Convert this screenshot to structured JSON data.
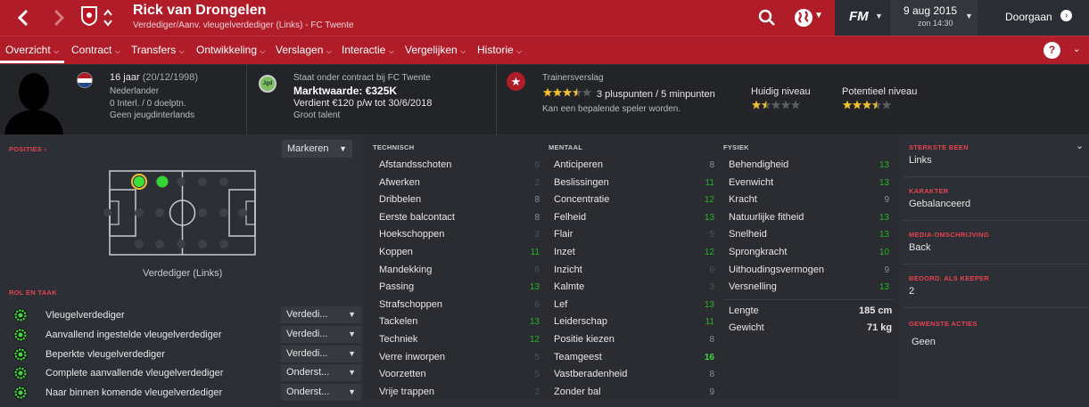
{
  "header": {
    "player_name": "Rick van Drongelen",
    "subtitle": "Verdediger/Aanv. vleugelverdediger (Links) - FC Twente",
    "date": "9 aug 2015",
    "time": "zon 14:30",
    "continue_label": "Doorgaan",
    "fm_logo": "FM"
  },
  "nav": {
    "items": [
      "Overzicht",
      "Contract",
      "Transfers",
      "Ontwikkeling",
      "Verslagen",
      "Interactie",
      "Vergelijken",
      "Historie"
    ],
    "help": "?"
  },
  "info": {
    "age": "16 jaar",
    "dob": "(20/12/1998)",
    "nationality": "Nederlander",
    "caps": "0 Interl. / 0 doelptn.",
    "youth_caps": "Geen jeugdinterlands",
    "contract_status": "Staat onder contract bij FC Twente",
    "club_badge": "Jgd",
    "market_value": "Marktwaarde: €325K",
    "wage": "Verdient €120 p/w tot 30/6/2018",
    "talent": "Groot talent",
    "scout_title": "Trainersverslag",
    "scout_points": "3 pluspunten / 5 minpunten",
    "scout_note": "Kan een bepalende speler worden.",
    "current_level_label": "Huidig niveau",
    "potential_level_label": "Potentieel niveau",
    "scout_stars": 3.5,
    "current_stars": 1.5,
    "potential_stars": 3.5
  },
  "positions": {
    "title": "POSITIES",
    "dropdown": "Markeren",
    "position_label": "Verdediger (Links)"
  },
  "roles": {
    "title": "ROL EN TAAK",
    "items": [
      {
        "name": "Vleugelverdediger",
        "duty": "Verdedi..."
      },
      {
        "name": "Aanvallend ingestelde vleugelverdediger",
        "duty": "Verdedi..."
      },
      {
        "name": "Beperkte vleugelverdediger",
        "duty": "Verdedi..."
      },
      {
        "name": "Complete aanvallende vleugelverdediger",
        "duty": "Onderst..."
      },
      {
        "name": "Naar binnen komende vleugelverdediger",
        "duty": "Onderst..."
      }
    ]
  },
  "technical": {
    "title": "TECHNISCH",
    "attrs": [
      {
        "name": "Afstandsschoten",
        "value": "6"
      },
      {
        "name": "Afwerken",
        "value": "2"
      },
      {
        "name": "Dribbelen",
        "value": "8"
      },
      {
        "name": "Eerste balcontact",
        "value": "8"
      },
      {
        "name": "Hoekschoppen",
        "value": "3"
      },
      {
        "name": "Koppen",
        "value": "11"
      },
      {
        "name": "Mandekking",
        "value": "6"
      },
      {
        "name": "Passing",
        "value": "13"
      },
      {
        "name": "Strafschoppen",
        "value": "6"
      },
      {
        "name": "Tackelen",
        "value": "13"
      },
      {
        "name": "Techniek",
        "value": "12"
      },
      {
        "name": "Verre inworpen",
        "value": "5"
      },
      {
        "name": "Voorzetten",
        "value": "5"
      },
      {
        "name": "Vrije trappen",
        "value": "2"
      }
    ]
  },
  "mental": {
    "title": "MENTAAL",
    "attrs": [
      {
        "name": "Anticiperen",
        "value": "8"
      },
      {
        "name": "Beslissingen",
        "value": "11"
      },
      {
        "name": "Concentratie",
        "value": "12"
      },
      {
        "name": "Felheid",
        "value": "13"
      },
      {
        "name": "Flair",
        "value": "5"
      },
      {
        "name": "Inzet",
        "value": "12"
      },
      {
        "name": "Inzicht",
        "value": "6"
      },
      {
        "name": "Kalmte",
        "value": "3"
      },
      {
        "name": "Lef",
        "value": "13"
      },
      {
        "name": "Leiderschap",
        "value": "11"
      },
      {
        "name": "Positie kiezen",
        "value": "8"
      },
      {
        "name": "Teamgeest",
        "value": "16"
      },
      {
        "name": "Vastberadenheid",
        "value": "8"
      },
      {
        "name": "Zonder bal",
        "value": "9"
      }
    ]
  },
  "physical": {
    "title": "FYSIEK",
    "attrs": [
      {
        "name": "Behendigheid",
        "value": "13"
      },
      {
        "name": "Evenwicht",
        "value": "13"
      },
      {
        "name": "Kracht",
        "value": "9"
      },
      {
        "name": "Natuurlijke fitheid",
        "value": "13"
      },
      {
        "name": "Snelheid",
        "value": "13"
      },
      {
        "name": "Sprongkracht",
        "value": "10"
      },
      {
        "name": "Uithoudingsvermogen",
        "value": "9"
      },
      {
        "name": "Versnelling",
        "value": "13"
      }
    ],
    "height_label": "Lengte",
    "height": "185 cm",
    "weight_label": "Gewicht",
    "weight": "71 kg"
  },
  "sidebar": {
    "strong_foot_title": "STERKSTE BEEN",
    "strong_foot": "Links",
    "character_title": "KARAKTER",
    "character": "Gebalanceerd",
    "media_title": "MEDIA-OMSCHRIJVING",
    "media": "Back",
    "keeper_title": "BEOORD. ALS KEEPER",
    "keeper": "2",
    "actions_title": "GEWENSTE ACTIES",
    "actions": "Geen"
  }
}
